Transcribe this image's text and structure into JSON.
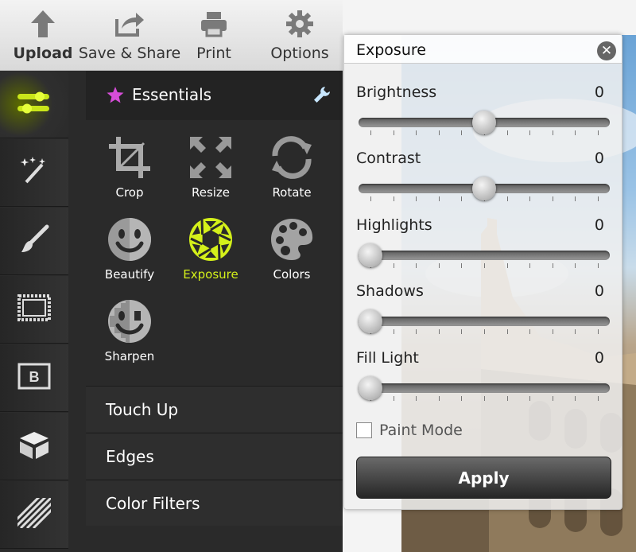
{
  "toolbar": {
    "upload": "Upload",
    "save_share": "Save & Share",
    "print": "Print",
    "options": "Options"
  },
  "rail": {
    "items": [
      {
        "icon": "adjustments-icon",
        "active": true
      },
      {
        "icon": "magic-wand-icon"
      },
      {
        "icon": "brush-icon"
      },
      {
        "icon": "frame-icon"
      },
      {
        "icon": "text-b-icon"
      },
      {
        "icon": "box-icon"
      },
      {
        "icon": "pattern-icon"
      }
    ]
  },
  "panel": {
    "title": "Essentials",
    "tools": [
      {
        "label": "Crop",
        "icon": "crop-icon"
      },
      {
        "label": "Resize",
        "icon": "resize-icon"
      },
      {
        "label": "Rotate",
        "icon": "rotate-icon"
      },
      {
        "label": "Beautify",
        "icon": "face-icon"
      },
      {
        "label": "Exposure",
        "icon": "aperture-icon",
        "active": true
      },
      {
        "label": "Colors",
        "icon": "palette-icon"
      },
      {
        "label": "Sharpen",
        "icon": "sharpen-face-icon"
      }
    ],
    "sections": [
      "Touch Up",
      "Edges",
      "Color Filters"
    ]
  },
  "dialog": {
    "title": "Exposure",
    "sliders": [
      {
        "label": "Brightness",
        "value": "0",
        "position": 0.5
      },
      {
        "label": "Contrast",
        "value": "0",
        "position": 0.5
      },
      {
        "label": "Highlights",
        "value": "0",
        "position": 0.0
      },
      {
        "label": "Shadows",
        "value": "0",
        "position": 0.0
      },
      {
        "label": "Fill Light",
        "value": "0",
        "position": 0.0
      }
    ],
    "paint_mode": "Paint Mode",
    "paint_mode_checked": false,
    "apply": "Apply"
  },
  "colors": {
    "accent": "#d4f01a",
    "panel_bg": "#2a2a2a"
  }
}
